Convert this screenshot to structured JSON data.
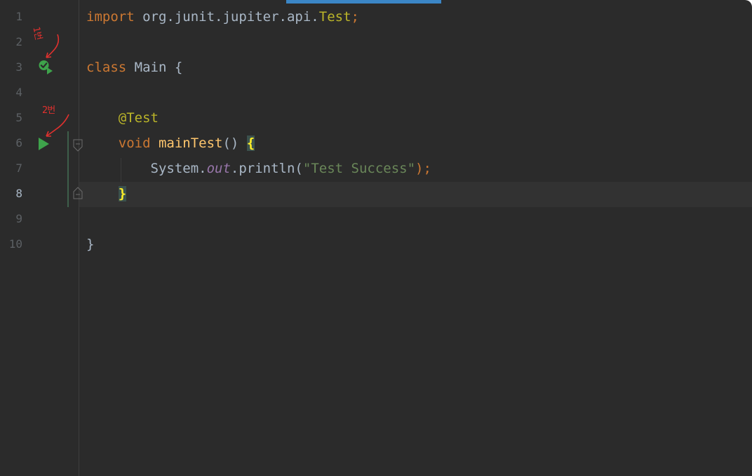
{
  "editor": {
    "lines": [
      {
        "number": "1",
        "tokens": [
          {
            "text": "import ",
            "cls": "kw"
          },
          {
            "text": "org.junit.jupiter.api.",
            "cls": "plain"
          },
          {
            "text": "Test",
            "cls": "ann"
          },
          {
            "text": ";",
            "cls": "kw"
          }
        ]
      },
      {
        "number": "2",
        "tokens": []
      },
      {
        "number": "3",
        "tokens": [
          {
            "text": "class ",
            "cls": "kw"
          },
          {
            "text": "Main {",
            "cls": "plain"
          }
        ]
      },
      {
        "number": "4",
        "tokens": []
      },
      {
        "number": "5",
        "tokens": [
          {
            "text": "    @Test",
            "cls": "ann"
          }
        ]
      },
      {
        "number": "6",
        "tokens": [
          {
            "text": "    void ",
            "cls": "kw"
          },
          {
            "text": "mainTest",
            "cls": "fn"
          },
          {
            "text": "() ",
            "cls": "plain"
          },
          {
            "text": "{",
            "cls": "brace-hl"
          }
        ]
      },
      {
        "number": "7",
        "tokens": [
          {
            "text": "        System.",
            "cls": "plain"
          },
          {
            "text": "out",
            "cls": "ital"
          },
          {
            "text": ".println(",
            "cls": "plain"
          },
          {
            "text": "\"Test Success\"",
            "cls": "str"
          },
          {
            "text": ");",
            "cls": "kw"
          }
        ]
      },
      {
        "number": "8",
        "tokens": [
          {
            "text": "    ",
            "cls": "plain"
          },
          {
            "text": "}",
            "cls": "brace-hl"
          }
        ]
      },
      {
        "number": "9",
        "tokens": []
      },
      {
        "number": "10",
        "tokens": [
          {
            "text": "}",
            "cls": "plain"
          }
        ]
      }
    ],
    "current_line": 8
  },
  "gutter": {
    "run_class_icon": "run-test-class-icon",
    "run_method_icon": "run-test-method-icon",
    "fold_icon": "fold-icon"
  },
  "annotations": {
    "first": "1번",
    "second": "2번"
  },
  "colors": {
    "background": "#2b2b2b",
    "keyword": "#cc7832",
    "annotation": "#bbb529",
    "string": "#6a8759",
    "function": "#ffc66d",
    "run_icon": "#3ea34b",
    "handwriting": "#e0312e"
  }
}
